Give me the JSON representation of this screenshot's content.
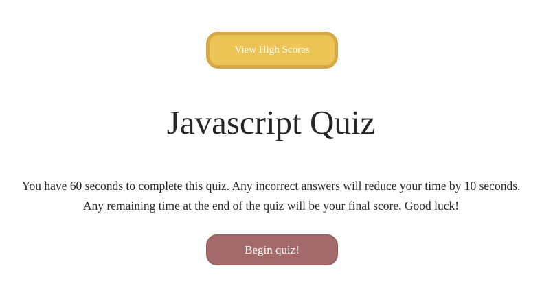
{
  "header": {
    "high_scores_label": "View High Scores"
  },
  "main": {
    "title": "Javascript Quiz",
    "instructions": "You have 60 seconds to complete this quiz. Any incorrect answers will reduce your time by 10 seconds. Any remaining time at the end of the quiz will be your final score. Good luck!",
    "begin_label": "Begin quiz!"
  },
  "colors": {
    "high_scores_button": "#ecc456",
    "high_scores_border": "#d9a846",
    "begin_button": "#a46a69",
    "text": "#2b2626"
  }
}
